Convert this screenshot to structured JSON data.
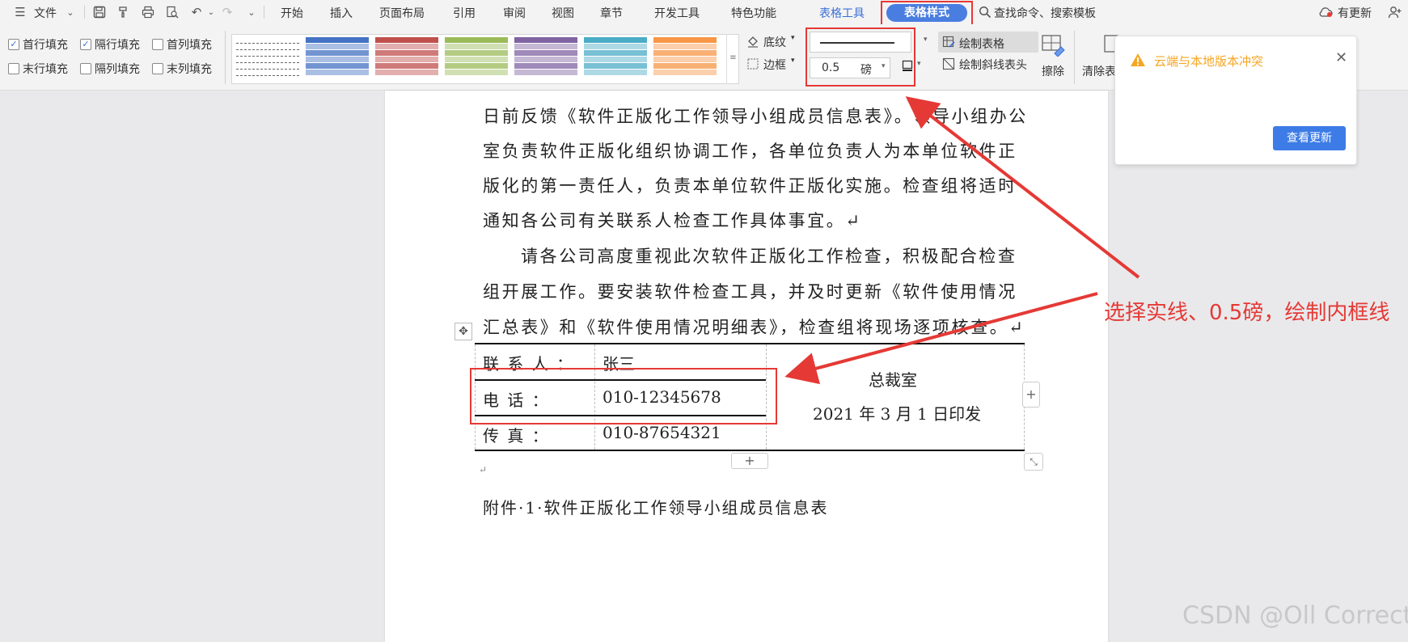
{
  "menubar": {
    "file_label": "文件",
    "tabs": [
      {
        "label": "开始"
      },
      {
        "label": "插入"
      },
      {
        "label": "页面布局"
      },
      {
        "label": "引用"
      },
      {
        "label": "审阅"
      },
      {
        "label": "视图"
      },
      {
        "label": "章节"
      },
      {
        "label": "开发工具"
      },
      {
        "label": "特色功能"
      },
      {
        "label": "表格工具"
      },
      {
        "label": "表格样式"
      }
    ],
    "search_label": "查找命令、搜索模板",
    "update_label": "有更新"
  },
  "ribbon": {
    "checks": [
      {
        "label": "首行填充",
        "checked": true
      },
      {
        "label": "隔行填充",
        "checked": true
      },
      {
        "label": "首列填充",
        "checked": false
      },
      {
        "label": "末行填充",
        "checked": false
      },
      {
        "label": "隔列填充",
        "checked": false
      },
      {
        "label": "末列填充",
        "checked": false
      }
    ],
    "shading_label": "底纹",
    "border_label": "边框",
    "line_weight_value": "0.5",
    "line_weight_unit": "磅",
    "draw_table_label": "绘制表格",
    "draw_diagonal_label": "绘制斜线表头",
    "erase_label": "擦除",
    "clear_label": "清除表"
  },
  "swatch_colors": [
    "#555555",
    "#4472c4",
    "#c0504d",
    "#9bbb59",
    "#8064a2",
    "#4bacc6",
    "#f79646"
  ],
  "document": {
    "paragraphs": [
      "日前反馈《软件正版化工作领导小组成员信息表》。领导小组办公",
      "室负责软件正版化组织协调工作，各单位负责人为本单位软件正",
      "版化的第一责任人，负责本单位软件正版化实施。检查组将适时",
      "通知各公司有关联系人检查工作具体事宜。↵",
      "请各公司高度重视此次软件正版化工作检查，积极配合检查",
      "组开展工作。要安装软件检查工具，并及时更新《软件使用情况",
      "汇总表》和《软件使用情况明细表》，检查组将现场逐项核查。↵"
    ],
    "table": {
      "rows": [
        {
          "label": "联 系 人 ：",
          "value": "张三"
        },
        {
          "label": "电    话    ：",
          "value": "010-12345678"
        },
        {
          "label": "传    真    ：",
          "value": "010-87654321"
        }
      ],
      "right_line1": "总裁室",
      "right_line2": "2021 年 3 月 1 日印发"
    },
    "attachment": "附件·1·软件正版化工作领导小组成员信息表",
    "return_mark": "↵"
  },
  "popup": {
    "message": "云端与本地版本冲突",
    "button_label": "查看更新"
  },
  "annotation": "选择实线、0.5磅，绘制内框线",
  "watermark": "CSDN @Oll Correct"
}
